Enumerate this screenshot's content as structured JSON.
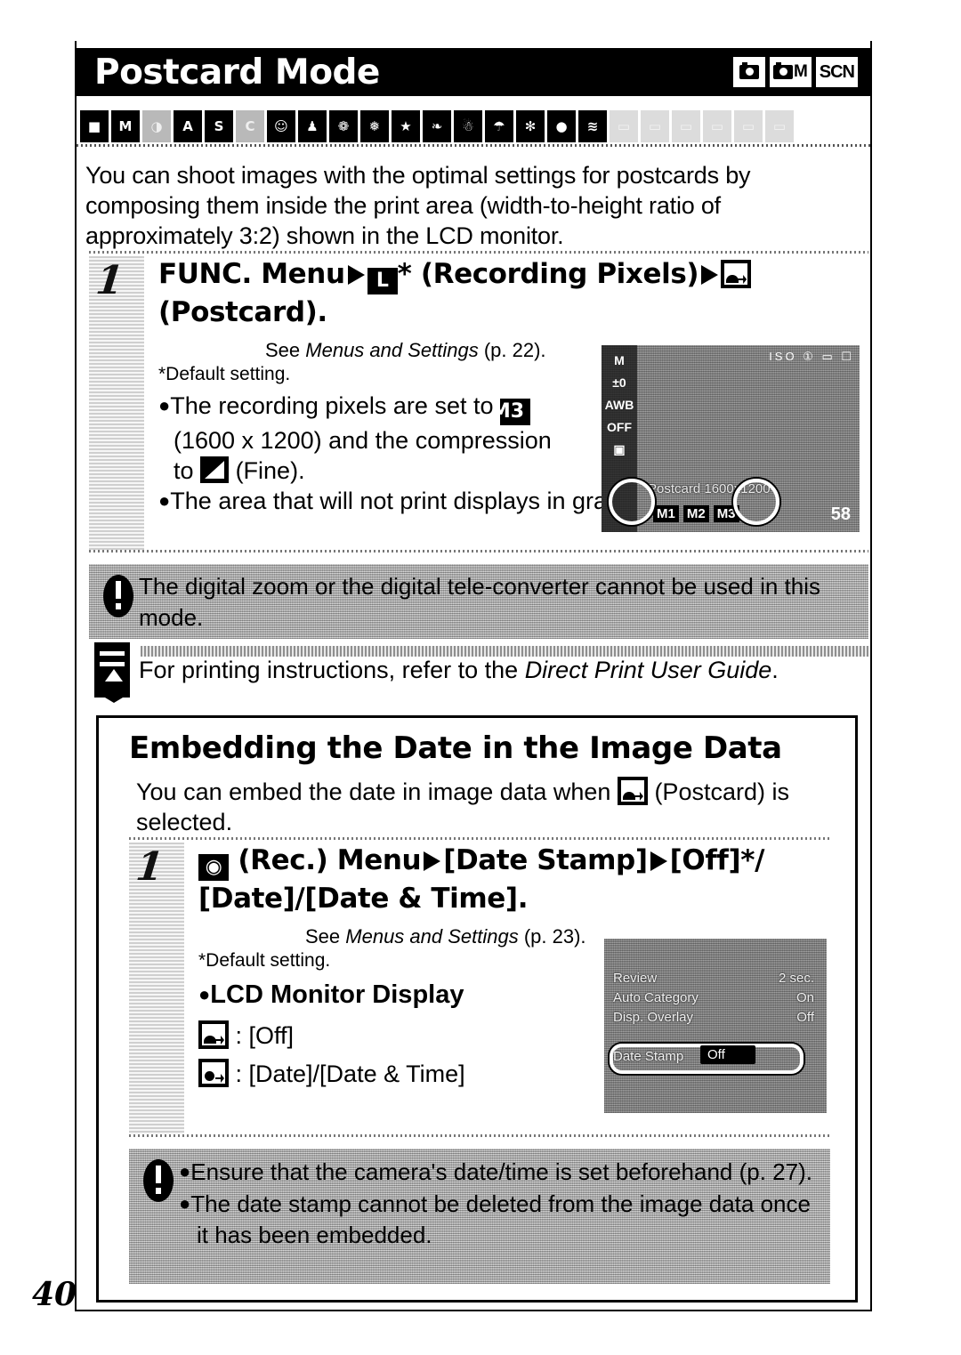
{
  "header": {
    "title": "Postcard Mode",
    "badges": [
      {
        "name": "camera-badge",
        "label": ""
      },
      {
        "name": "camera-m-badge",
        "label": "M"
      },
      {
        "name": "scn-badge",
        "label": "SCN"
      }
    ]
  },
  "mode_strip": {
    "icons": [
      {
        "name": "auto-mode-icon",
        "glyph": "■",
        "state": "active"
      },
      {
        "name": "manual-mode-icon",
        "glyph": "M",
        "state": "active"
      },
      {
        "name": "digital-macro-icon",
        "glyph": "◑",
        "state": "dim"
      },
      {
        "name": "aperture-priority-icon",
        "glyph": "A",
        "state": "active"
      },
      {
        "name": "shutter-priority-icon",
        "glyph": "S",
        "state": "active"
      },
      {
        "name": "custom-mode-icon",
        "glyph": "C",
        "state": "dim"
      },
      {
        "name": "portrait-mode-icon",
        "glyph": "☺",
        "state": "active"
      },
      {
        "name": "night-snapshot-icon",
        "glyph": "♟",
        "state": "active"
      },
      {
        "name": "kids-pets-icon",
        "glyph": "❁",
        "state": "active"
      },
      {
        "name": "indoor-icon",
        "glyph": "❅",
        "state": "active"
      },
      {
        "name": "party-icon",
        "glyph": "★",
        "state": "active"
      },
      {
        "name": "foliage-icon",
        "glyph": "❧",
        "state": "active"
      },
      {
        "name": "snow-icon",
        "glyph": "☃",
        "state": "active"
      },
      {
        "name": "beach-icon",
        "glyph": "☂",
        "state": "active"
      },
      {
        "name": "fireworks-icon",
        "glyph": "✻",
        "state": "active"
      },
      {
        "name": "aquarium-icon",
        "glyph": "●",
        "state": "active"
      },
      {
        "name": "underwater-icon",
        "glyph": "≋",
        "state": "active"
      },
      {
        "name": "stitch-assist-icon",
        "glyph": "▭",
        "state": "ghost"
      },
      {
        "name": "movie-icon",
        "glyph": "▭",
        "state": "ghost"
      },
      {
        "name": "playback-icon",
        "glyph": "▭",
        "state": "ghost"
      },
      {
        "name": "print-icon",
        "glyph": "▭",
        "state": "ghost"
      },
      {
        "name": "setup-icon",
        "glyph": "▭",
        "state": "ghost"
      },
      {
        "name": "mymenu-icon",
        "glyph": "▭",
        "state": "ghost"
      }
    ]
  },
  "intro": "You can shoot images with the optimal settings for postcards by composing them inside the print area (width-to-height ratio of approximately 3:2) shown in the LCD monitor.",
  "step1": {
    "number": "1",
    "title_part1": "FUNC. Menu",
    "title_key": "L",
    "title_part2": "* (Recording Pixels)",
    "title_part3": "(Postcard).",
    "see": "See ",
    "see_italic": "Menus and Settings",
    "see_page": " (p. 22).",
    "default_note": "*Default setting.",
    "bullet1_a": "The recording pixels are set to",
    "bullet1_key": "M3",
    "bullet1_b": "(1600 x 1200) and the compression",
    "bullet1_c": "to",
    "bullet1_d": "(Fine).",
    "bullet2": "The area that will not print displays in gray."
  },
  "lcd1": {
    "mode_label": "M",
    "sidebar": [
      "±0",
      "AWB",
      "OFF",
      "▣"
    ],
    "top_icons": "ISO ① ▭ ☐",
    "caption": "Postcard 1600x1200",
    "options": [
      "M1",
      "M2",
      "M3"
    ],
    "counter": "58"
  },
  "note1": "The digital zoom or the digital tele-converter cannot be used in this mode.",
  "ref1_a": "For printing instructions, refer to the ",
  "ref1_italic": "Direct Print User Guide",
  "ref1_b": ".",
  "section2": {
    "title": "Embedding the Date in the Image Data",
    "intro_a": "You can embed the date in image data when",
    "intro_b": "(Postcard) is selected.",
    "step": {
      "number": "1",
      "title_a": "(Rec.) Menu",
      "title_b": "[Date Stamp]",
      "title_c": "[Off]*/",
      "title_d": "[Date]/[Date & Time].",
      "see": "See ",
      "see_italic": "Menus and Settings",
      "see_page": " (p. 23).",
      "default_note": "*Default setting.",
      "lcd_heading": "LCD Monitor Display",
      "opt1": ": [Off]",
      "opt2": ": [Date]/[Date & Time]"
    },
    "lcd2": {
      "rows": [
        {
          "label": "Review",
          "value": "2 sec."
        },
        {
          "label": "Auto Category",
          "value": "On"
        },
        {
          "label": "Disp. Overlay",
          "value": "Off"
        }
      ],
      "highlight_label": "Date Stamp",
      "highlight_value": "Off"
    },
    "warnings": [
      "Ensure that the camera's date/time is set beforehand (p. 27).",
      "The date stamp cannot be deleted from the image data once it has been embedded."
    ]
  },
  "page_number": "40"
}
